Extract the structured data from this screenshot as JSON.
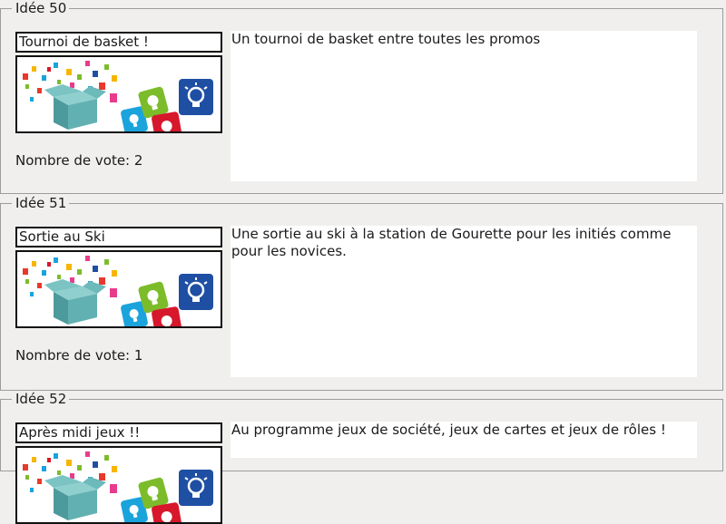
{
  "ideas": [
    {
      "legend": "Idée 50",
      "title": "Tournoi de basket !",
      "image_icon": "idea-box-illustration",
      "description": "Un tournoi de basket entre toutes les promos",
      "votes": "Nombre de vote: 2"
    },
    {
      "legend": "Idée 51",
      "title": "Sortie au Ski",
      "image_icon": "idea-box-illustration",
      "description": "Une sortie au ski à la station de Gourette pour les initiés comme pour les novices.",
      "votes": "Nombre de vote: 1"
    },
    {
      "legend": "Idée 52",
      "title": "Après midi jeux !!",
      "image_icon": "idea-box-illustration",
      "description": "Au programme jeux de société, jeux de cartes et jeux de rôles !",
      "votes": ""
    }
  ],
  "colors": {
    "background": "#f0efed",
    "border": "#9c9c9c",
    "box_teal": "#5aa6a8",
    "tile_blue": "#1f4fa3",
    "tile_red": "#d7172b",
    "tile_green": "#7cbc2b",
    "tile_cyan": "#1ba3dc"
  }
}
